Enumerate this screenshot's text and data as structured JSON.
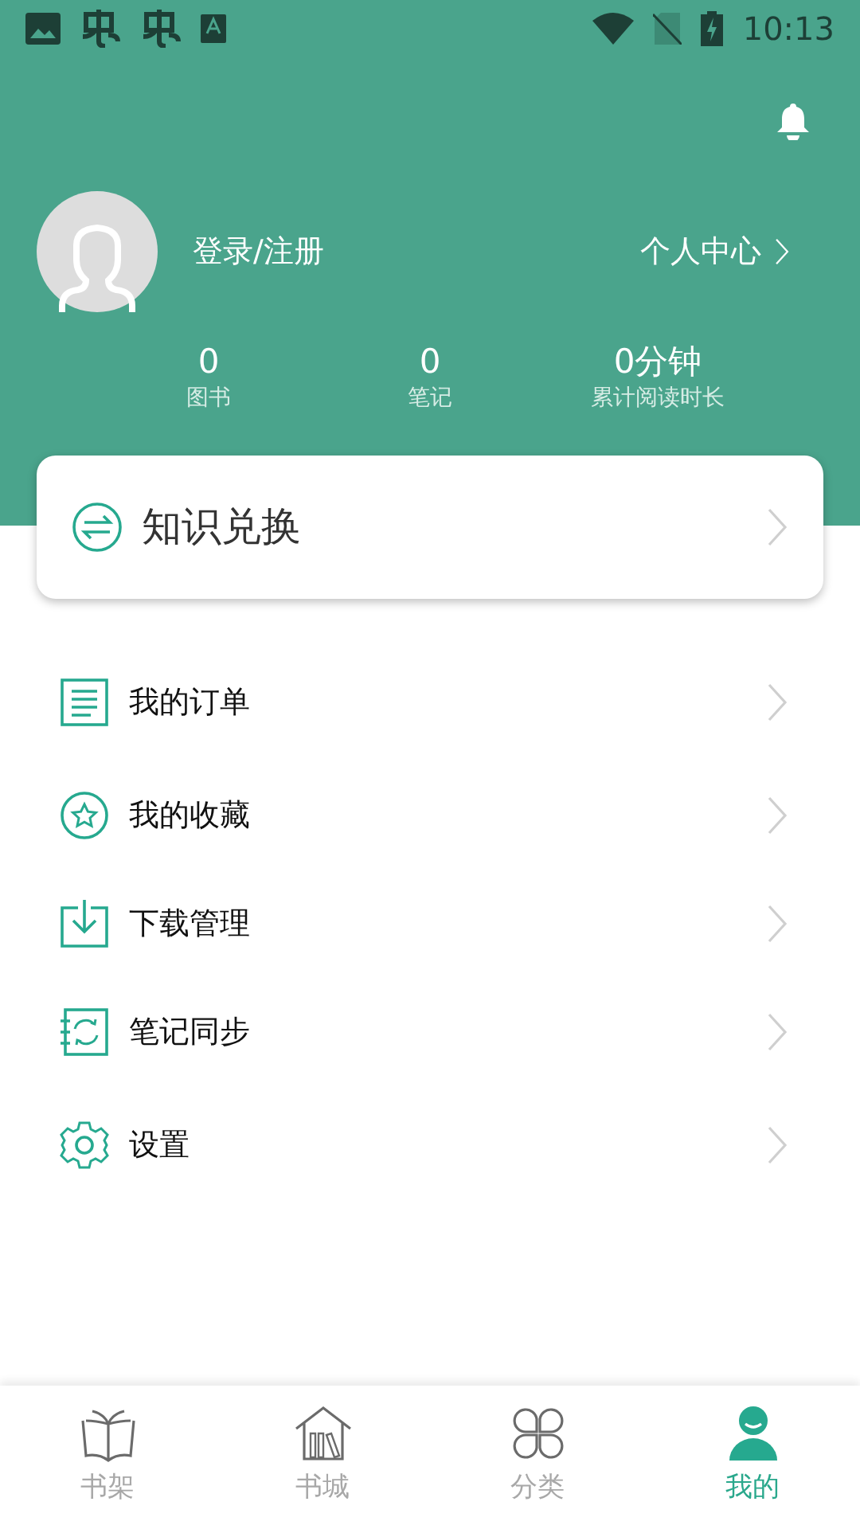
{
  "status_bar": {
    "time": "10:13"
  },
  "profile": {
    "login": "登录/注册",
    "center_link": "个人中心"
  },
  "stats": [
    {
      "value": "0",
      "label": "图书"
    },
    {
      "value": "0",
      "label": "笔记"
    },
    {
      "value": "0分钟",
      "label": "累计阅读时长"
    }
  ],
  "exchange_card": {
    "label": "知识兑换"
  },
  "menu": [
    {
      "kind": "order",
      "label": "我的订单"
    },
    {
      "kind": "favorite",
      "label": "我的收藏"
    },
    {
      "kind": "download",
      "label": "下载管理"
    },
    {
      "kind": "sync",
      "label": "笔记同步"
    },
    {
      "kind": "settings",
      "label": "设置"
    }
  ],
  "tabs": [
    {
      "kind": "shelf",
      "label": "书架",
      "selected": false
    },
    {
      "kind": "store",
      "label": "书城",
      "selected": false
    },
    {
      "kind": "category",
      "label": "分类",
      "selected": false
    },
    {
      "kind": "mine",
      "label": "我的",
      "selected": true
    }
  ]
}
